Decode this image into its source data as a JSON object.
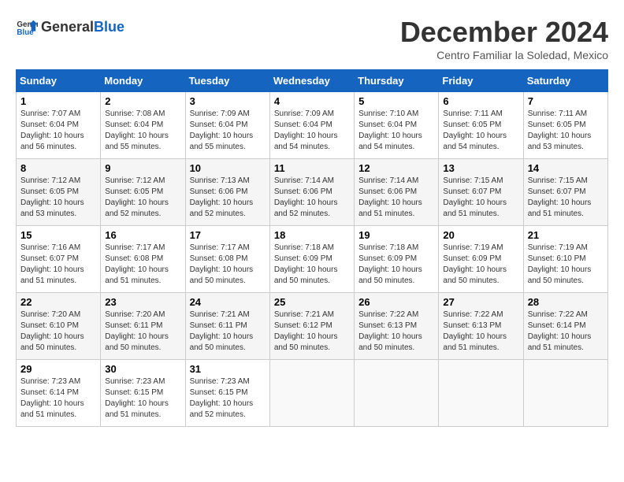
{
  "header": {
    "logo": {
      "general": "General",
      "blue": "Blue"
    },
    "title": "December 2024",
    "subtitle": "Centro Familiar la Soledad, Mexico"
  },
  "calendar": {
    "days_of_week": [
      "Sunday",
      "Monday",
      "Tuesday",
      "Wednesday",
      "Thursday",
      "Friday",
      "Saturday"
    ],
    "weeks": [
      [
        null,
        {
          "day": "2",
          "sunrise": "7:08 AM",
          "sunset": "6:04 PM",
          "daylight": "10 hours and 55 minutes."
        },
        {
          "day": "3",
          "sunrise": "7:09 AM",
          "sunset": "6:04 PM",
          "daylight": "10 hours and 55 minutes."
        },
        {
          "day": "4",
          "sunrise": "7:09 AM",
          "sunset": "6:04 PM",
          "daylight": "10 hours and 54 minutes."
        },
        {
          "day": "5",
          "sunrise": "7:10 AM",
          "sunset": "6:04 PM",
          "daylight": "10 hours and 54 minutes."
        },
        {
          "day": "6",
          "sunrise": "7:11 AM",
          "sunset": "6:05 PM",
          "daylight": "10 hours and 54 minutes."
        },
        {
          "day": "7",
          "sunrise": "7:11 AM",
          "sunset": "6:05 PM",
          "daylight": "10 hours and 53 minutes."
        }
      ],
      [
        {
          "day": "1",
          "sunrise": "7:07 AM",
          "sunset": "6:04 PM",
          "daylight": "10 hours and 56 minutes."
        },
        {
          "day": "9",
          "sunrise": "7:12 AM",
          "sunset": "6:05 PM",
          "daylight": "10 hours and 52 minutes."
        },
        {
          "day": "10",
          "sunrise": "7:13 AM",
          "sunset": "6:06 PM",
          "daylight": "10 hours and 52 minutes."
        },
        {
          "day": "11",
          "sunrise": "7:14 AM",
          "sunset": "6:06 PM",
          "daylight": "10 hours and 52 minutes."
        },
        {
          "day": "12",
          "sunrise": "7:14 AM",
          "sunset": "6:06 PM",
          "daylight": "10 hours and 51 minutes."
        },
        {
          "day": "13",
          "sunrise": "7:15 AM",
          "sunset": "6:07 PM",
          "daylight": "10 hours and 51 minutes."
        },
        {
          "day": "14",
          "sunrise": "7:15 AM",
          "sunset": "6:07 PM",
          "daylight": "10 hours and 51 minutes."
        }
      ],
      [
        {
          "day": "8",
          "sunrise": "7:12 AM",
          "sunset": "6:05 PM",
          "daylight": "10 hours and 53 minutes."
        },
        {
          "day": "16",
          "sunrise": "7:17 AM",
          "sunset": "6:08 PM",
          "daylight": "10 hours and 51 minutes."
        },
        {
          "day": "17",
          "sunrise": "7:17 AM",
          "sunset": "6:08 PM",
          "daylight": "10 hours and 50 minutes."
        },
        {
          "day": "18",
          "sunrise": "7:18 AM",
          "sunset": "6:09 PM",
          "daylight": "10 hours and 50 minutes."
        },
        {
          "day": "19",
          "sunrise": "7:18 AM",
          "sunset": "6:09 PM",
          "daylight": "10 hours and 50 minutes."
        },
        {
          "day": "20",
          "sunrise": "7:19 AM",
          "sunset": "6:09 PM",
          "daylight": "10 hours and 50 minutes."
        },
        {
          "day": "21",
          "sunrise": "7:19 AM",
          "sunset": "6:10 PM",
          "daylight": "10 hours and 50 minutes."
        }
      ],
      [
        {
          "day": "15",
          "sunrise": "7:16 AM",
          "sunset": "6:07 PM",
          "daylight": "10 hours and 51 minutes."
        },
        {
          "day": "23",
          "sunrise": "7:20 AM",
          "sunset": "6:11 PM",
          "daylight": "10 hours and 50 minutes."
        },
        {
          "day": "24",
          "sunrise": "7:21 AM",
          "sunset": "6:11 PM",
          "daylight": "10 hours and 50 minutes."
        },
        {
          "day": "25",
          "sunrise": "7:21 AM",
          "sunset": "6:12 PM",
          "daylight": "10 hours and 50 minutes."
        },
        {
          "day": "26",
          "sunrise": "7:22 AM",
          "sunset": "6:13 PM",
          "daylight": "10 hours and 50 minutes."
        },
        {
          "day": "27",
          "sunrise": "7:22 AM",
          "sunset": "6:13 PM",
          "daylight": "10 hours and 51 minutes."
        },
        {
          "day": "28",
          "sunrise": "7:22 AM",
          "sunset": "6:14 PM",
          "daylight": "10 hours and 51 minutes."
        }
      ],
      [
        {
          "day": "22",
          "sunrise": "7:20 AM",
          "sunset": "6:10 PM",
          "daylight": "10 hours and 50 minutes."
        },
        {
          "day": "30",
          "sunrise": "7:23 AM",
          "sunset": "6:15 PM",
          "daylight": "10 hours and 51 minutes."
        },
        {
          "day": "31",
          "sunrise": "7:23 AM",
          "sunset": "6:15 PM",
          "daylight": "10 hours and 52 minutes."
        },
        null,
        null,
        null,
        null
      ],
      [
        {
          "day": "29",
          "sunrise": "7:23 AM",
          "sunset": "6:14 PM",
          "daylight": "10 hours and 51 minutes."
        },
        null,
        null,
        null,
        null,
        null,
        null
      ]
    ]
  }
}
